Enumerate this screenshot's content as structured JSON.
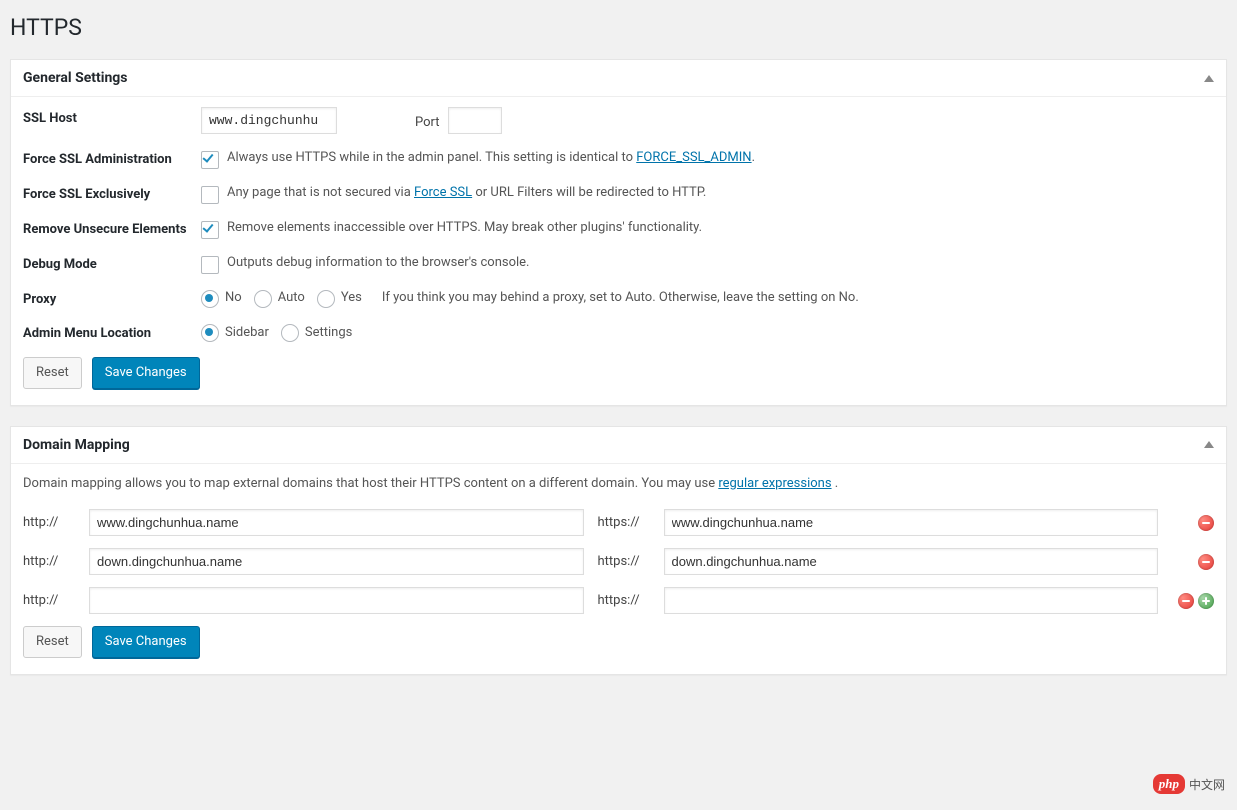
{
  "page": {
    "title": "HTTPS"
  },
  "general": {
    "heading": "General Settings",
    "rows": {
      "ssl_host": {
        "label": "SSL Host",
        "value": "www.dingchunhu",
        "port_label": "Port",
        "port_value": ""
      },
      "force_admin": {
        "label": "Force SSL Administration",
        "checked": true,
        "desc_pre": "Always use HTTPS while in the admin panel. This setting is identical to ",
        "link": "FORCE_SSL_ADMIN",
        "desc_post": "."
      },
      "force_excl": {
        "label": "Force SSL Exclusively",
        "checked": false,
        "desc_pre": "Any page that is not secured via ",
        "link": "Force SSL",
        "desc_post": " or URL Filters will be redirected to HTTP."
      },
      "remove_unsecure": {
        "label": "Remove Unsecure Elements",
        "checked": true,
        "desc": "Remove elements inaccessible over HTTPS. May break other plugins' functionality."
      },
      "debug": {
        "label": "Debug Mode",
        "checked": false,
        "desc": "Outputs debug information to the browser's console."
      },
      "proxy": {
        "label": "Proxy",
        "options": {
          "no": "No",
          "auto": "Auto",
          "yes": "Yes"
        },
        "selected": "no",
        "hint": "If you think you may behind a proxy, set to Auto. Otherwise, leave the setting on No."
      },
      "admin_loc": {
        "label": "Admin Menu Location",
        "options": {
          "sidebar": "Sidebar",
          "settings": "Settings"
        },
        "selected": "sidebar"
      }
    },
    "buttons": {
      "reset": "Reset",
      "save": "Save Changes"
    }
  },
  "mapping": {
    "heading": "Domain Mapping",
    "desc_pre": "Domain mapping allows you to map external domains that host their HTTPS content on a different domain. You may use ",
    "link": "regular expressions",
    "desc_post": " .",
    "prefix_http": "http://",
    "prefix_https": "https://",
    "rows": [
      {
        "http": "www.dingchunhua.name",
        "https": "www.dingchunhua.name",
        "can_add": false
      },
      {
        "http": "down.dingchunhua.name",
        "https": "down.dingchunhua.name",
        "can_add": false
      },
      {
        "http": "",
        "https": "",
        "can_add": true
      }
    ],
    "buttons": {
      "reset": "Reset",
      "save": "Save Changes"
    }
  },
  "watermark": {
    "badge": "php",
    "text": "中文网"
  }
}
